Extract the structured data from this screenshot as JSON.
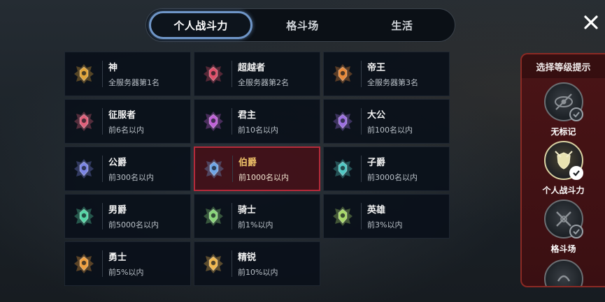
{
  "tabs": [
    {
      "label": "个人战斗力",
      "active": true
    },
    {
      "label": "格斗场",
      "active": false
    },
    {
      "label": "生活",
      "active": false
    }
  ],
  "close": {
    "icon": "close-icon",
    "color": "#ffffff"
  },
  "ranks": [
    {
      "name": "神",
      "desc": "全服务器第1名",
      "icon": "god-rank-icon",
      "color": "#e2a53a",
      "selected": false
    },
    {
      "name": "超越者",
      "desc": "全服务器第2名",
      "icon": "transcender-rank-icon",
      "color": "#e0506a",
      "selected": false
    },
    {
      "name": "帝王",
      "desc": "全服务器第3名",
      "icon": "emperor-rank-icon",
      "color": "#e88a3a",
      "selected": false
    },
    {
      "name": "征服者",
      "desc": "前6名以内",
      "icon": "conqueror-rank-icon",
      "color": "#e0607a",
      "selected": false
    },
    {
      "name": "君主",
      "desc": "前10名以内",
      "icon": "monarch-rank-icon",
      "color": "#c062d8",
      "selected": false
    },
    {
      "name": "大公",
      "desc": "前100名以内",
      "icon": "archduke-rank-icon",
      "color": "#9c70e0",
      "selected": false
    },
    {
      "name": "公爵",
      "desc": "前300名以内",
      "icon": "duke-rank-icon",
      "color": "#7c86e6",
      "selected": false
    },
    {
      "name": "伯爵",
      "desc": "前1000名以内",
      "icon": "earl-rank-icon",
      "color": "#70a6e6",
      "selected": true
    },
    {
      "name": "子爵",
      "desc": "前3000名以内",
      "icon": "viscount-rank-icon",
      "color": "#52c8c4",
      "selected": false
    },
    {
      "name": "男爵",
      "desc": "前5000名以内",
      "icon": "baron-rank-icon",
      "color": "#56d6a6",
      "selected": false
    },
    {
      "name": "骑士",
      "desc": "前1%以内",
      "icon": "knight-rank-icon",
      "color": "#8ad67a",
      "selected": false
    },
    {
      "name": "英雄",
      "desc": "前3%以内",
      "icon": "hero-rank-icon",
      "color": "#a8d86a",
      "selected": false
    },
    {
      "name": "勇士",
      "desc": "前5%以内",
      "icon": "warrior-rank-icon",
      "color": "#f0a040",
      "selected": false
    },
    {
      "name": "精锐",
      "desc": "前10%以内",
      "icon": "elite-rank-icon",
      "color": "#f0b850",
      "selected": false
    }
  ],
  "side_panel": {
    "title": "选择等级提示",
    "items": [
      {
        "label": "无标记",
        "icon": "no-mark-icon",
        "checked": true,
        "active": false
      },
      {
        "label": "个人战斗力",
        "icon": "sword-shield-icon",
        "checked": true,
        "active": true
      },
      {
        "label": "格斗场",
        "icon": "crossed-swords-icon",
        "checked": true,
        "active": false
      },
      {
        "label": "",
        "icon": "partial-badge-icon",
        "checked": false,
        "active": false
      }
    ]
  },
  "colors": {
    "accent_tab": "#6f96c8",
    "selected_border": "#b52a3a",
    "panel_red": "#4a1416"
  }
}
